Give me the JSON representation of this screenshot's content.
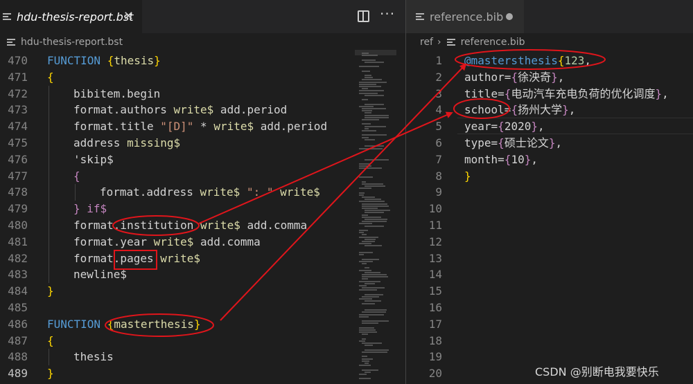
{
  "left": {
    "tab_title": "hdu-thesis-report.bst",
    "breadcrumb_file": "hdu-thesis-report.bst",
    "active_line": 489
  },
  "right": {
    "tab_title": "reference.bib",
    "breadcrumb_folder": "ref",
    "breadcrumb_file": "reference.bib"
  },
  "left_lines": [
    {
      "num": "470",
      "indent": 0,
      "tokens": [
        [
          "kw",
          "FUNCTION"
        ],
        [
          "pl",
          " "
        ],
        [
          "br",
          "{"
        ],
        [
          "fn",
          "thesis"
        ],
        [
          "br",
          "}"
        ]
      ]
    },
    {
      "num": "471",
      "indent": 0,
      "tokens": [
        [
          "br",
          "{"
        ]
      ]
    },
    {
      "num": "472",
      "indent": 1,
      "tokens": [
        [
          "pl",
          "bibitem.begin"
        ]
      ]
    },
    {
      "num": "473",
      "indent": 1,
      "tokens": [
        [
          "pl",
          "format.authors "
        ],
        [
          "fn",
          "write$"
        ],
        [
          "pl",
          " add.period"
        ]
      ]
    },
    {
      "num": "474",
      "indent": 1,
      "tokens": [
        [
          "pl",
          "format.title "
        ],
        [
          "str",
          "\"[D]\""
        ],
        [
          "pl",
          " * "
        ],
        [
          "fn",
          "write$"
        ],
        [
          "pl",
          " add.period"
        ]
      ]
    },
    {
      "num": "475",
      "indent": 1,
      "tokens": [
        [
          "pl",
          "address "
        ],
        [
          "fn",
          "missing$"
        ]
      ]
    },
    {
      "num": "476",
      "indent": 1,
      "tokens": [
        [
          "pl",
          "'skip$"
        ]
      ]
    },
    {
      "num": "477",
      "indent": 1,
      "tokens": [
        [
          "ctl",
          "{"
        ]
      ]
    },
    {
      "num": "478",
      "indent": 2,
      "tokens": [
        [
          "pl",
          "format.address "
        ],
        [
          "fn",
          "write$"
        ],
        [
          "pl",
          " "
        ],
        [
          "str",
          "\": \""
        ],
        [
          "pl",
          " "
        ],
        [
          "fn",
          "write$"
        ]
      ]
    },
    {
      "num": "479",
      "indent": 1,
      "tokens": [
        [
          "ctl",
          "}"
        ],
        [
          "pl",
          " "
        ],
        [
          "ctl",
          "if$"
        ]
      ]
    },
    {
      "num": "480",
      "indent": 1,
      "tokens": [
        [
          "pl",
          "format.institution "
        ],
        [
          "fn",
          "write$"
        ],
        [
          "pl",
          " add.comma"
        ]
      ]
    },
    {
      "num": "481",
      "indent": 1,
      "tokens": [
        [
          "pl",
          "format.year "
        ],
        [
          "fn",
          "write$"
        ],
        [
          "pl",
          " add.comma"
        ]
      ]
    },
    {
      "num": "482",
      "indent": 1,
      "tokens": [
        [
          "pl",
          "format.pages "
        ],
        [
          "fn",
          "write$"
        ]
      ]
    },
    {
      "num": "483",
      "indent": 1,
      "tokens": [
        [
          "pl",
          "newline$"
        ]
      ]
    },
    {
      "num": "484",
      "indent": 0,
      "tokens": [
        [
          "br",
          "}"
        ]
      ]
    },
    {
      "num": "485",
      "indent": 0,
      "tokens": []
    },
    {
      "num": "486",
      "indent": 0,
      "tokens": [
        [
          "kw",
          "FUNCTION"
        ],
        [
          "pl",
          " "
        ],
        [
          "br",
          "{"
        ],
        [
          "fn",
          "masterthesis"
        ],
        [
          "br",
          "}"
        ]
      ]
    },
    {
      "num": "487",
      "indent": 0,
      "tokens": [
        [
          "br",
          "{"
        ]
      ]
    },
    {
      "num": "488",
      "indent": 1,
      "tokens": [
        [
          "pl",
          "thesis"
        ]
      ]
    },
    {
      "num": "489",
      "indent": 0,
      "tokens": [
        [
          "br",
          "}"
        ]
      ]
    }
  ],
  "right_lines": [
    {
      "num": "1",
      "tokens": [
        [
          "type",
          "@mastersthesis"
        ],
        [
          "br",
          "{"
        ],
        [
          "num",
          "123"
        ],
        [
          "pl",
          ","
        ]
      ]
    },
    {
      "num": "2",
      "tokens": [
        [
          "pl",
          "author="
        ],
        [
          "ctl",
          "{"
        ],
        [
          "pl",
          "徐泱奇"
        ],
        [
          "ctl",
          "}"
        ],
        [
          "pl",
          ","
        ]
      ]
    },
    {
      "num": "3",
      "tokens": [
        [
          "pl",
          "title="
        ],
        [
          "ctl",
          "{"
        ],
        [
          "pl",
          "电动汽车充电负荷的优化调度"
        ],
        [
          "ctl",
          "}"
        ],
        [
          "pl",
          ","
        ]
      ]
    },
    {
      "num": "4",
      "tokens": [
        [
          "pl",
          "school="
        ],
        [
          "ctl",
          "{"
        ],
        [
          "pl",
          "扬州大学"
        ],
        [
          "ctl",
          "}"
        ],
        [
          "pl",
          ","
        ]
      ]
    },
    {
      "num": "5",
      "tokens": [
        [
          "pl",
          "year="
        ],
        [
          "ctl",
          "{"
        ],
        [
          "pl",
          "2020"
        ],
        [
          "ctl",
          "}"
        ],
        [
          "pl",
          ","
        ]
      ]
    },
    {
      "num": "6",
      "tokens": [
        [
          "pl",
          "type="
        ],
        [
          "ctl",
          "{"
        ],
        [
          "pl",
          "硕士论文"
        ],
        [
          "ctl",
          "}"
        ],
        [
          "pl",
          ","
        ]
      ]
    },
    {
      "num": "7",
      "tokens": [
        [
          "pl",
          "month="
        ],
        [
          "ctl",
          "{"
        ],
        [
          "pl",
          "10"
        ],
        [
          "ctl",
          "}"
        ],
        [
          "pl",
          ","
        ]
      ]
    },
    {
      "num": "8",
      "tokens": [
        [
          "br",
          "}"
        ]
      ]
    },
    {
      "num": "9",
      "tokens": []
    },
    {
      "num": "10",
      "tokens": []
    },
    {
      "num": "11",
      "tokens": []
    },
    {
      "num": "12",
      "tokens": []
    },
    {
      "num": "13",
      "tokens": []
    },
    {
      "num": "14",
      "tokens": []
    },
    {
      "num": "15",
      "tokens": []
    },
    {
      "num": "16",
      "tokens": []
    },
    {
      "num": "17",
      "tokens": []
    },
    {
      "num": "18",
      "tokens": []
    },
    {
      "num": "19",
      "tokens": []
    },
    {
      "num": "20",
      "tokens": []
    }
  ],
  "watermark": "CSDN @别断电我要快乐",
  "colors": {
    "annotation": "#e0151b",
    "editor_bg": "#1e1e1e",
    "keyword": "#569cd6",
    "function": "#dcdcaa",
    "string": "#ce9178"
  },
  "icons": {
    "tab_file": "lines-icon",
    "close": "close-icon",
    "unsaved": "unsaved-dot-icon",
    "split": "split-editor-icon",
    "more": "more-actions-icon"
  }
}
